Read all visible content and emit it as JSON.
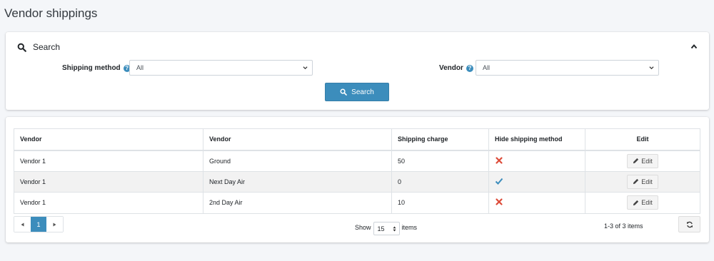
{
  "page": {
    "title": "Vendor shippings"
  },
  "search": {
    "title": "Search",
    "shipping_method_label": "Shipping method",
    "shipping_method_value": "All",
    "vendor_label": "Vendor",
    "vendor_value": "All",
    "button_label": "Search",
    "help_glyph": "?"
  },
  "grid": {
    "columns": [
      "Vendor",
      "Vendor",
      "Shipping charge",
      "Hide shipping method",
      "Edit"
    ],
    "rows": [
      {
        "vendor": "Vendor 1",
        "method": "Ground",
        "charge": "50",
        "hidden": false,
        "edit_label": "Edit"
      },
      {
        "vendor": "Vendor 1",
        "method": "Next Day Air",
        "charge": "0",
        "hidden": true,
        "edit_label": "Edit"
      },
      {
        "vendor": "Vendor 1",
        "method": "2nd Day Air",
        "charge": "10",
        "hidden": false,
        "edit_label": "Edit"
      }
    ]
  },
  "pager": {
    "current_page": "1",
    "show_label": "Show",
    "page_size": "15",
    "items_label": "items",
    "summary": "1-3 of 3 items"
  },
  "colors": {
    "primary": "#3c8dbc",
    "false_mark": "#dd4b39",
    "true_mark": "#3c8dbc"
  },
  "icons": {
    "search": "search-icon",
    "collapse": "chevron-up-icon",
    "help": "question-circle-icon",
    "edit": "pencil-icon",
    "refresh": "refresh-icon",
    "false": "cross-icon",
    "true": "check-icon"
  }
}
